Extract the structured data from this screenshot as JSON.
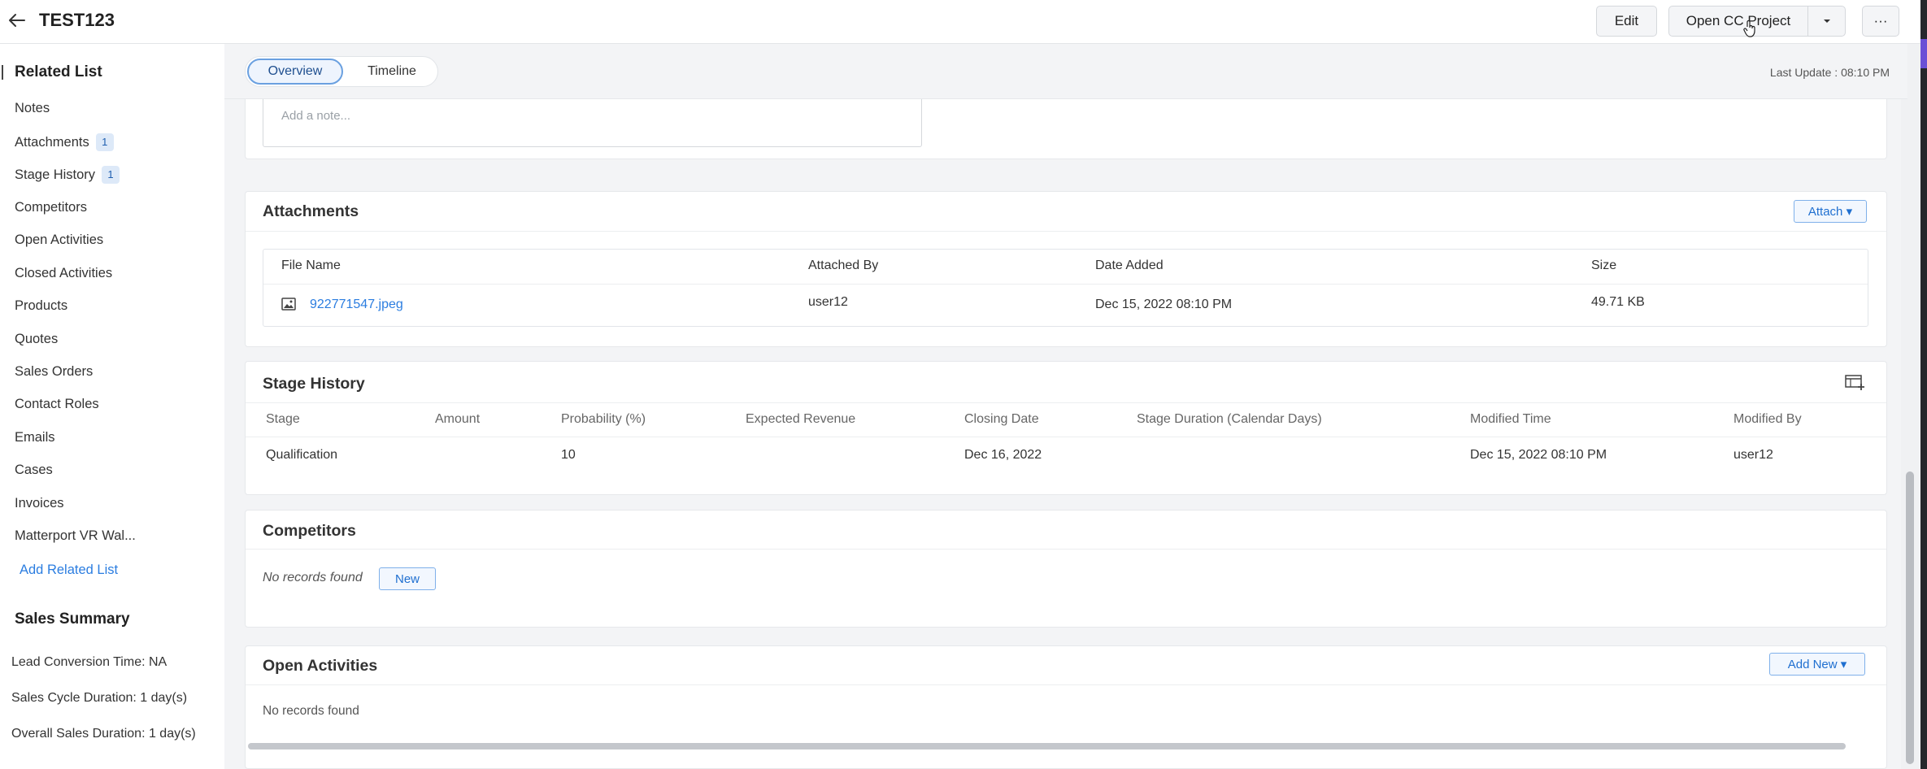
{
  "header": {
    "title": "TEST123",
    "edit_label": "Edit",
    "open_project_label": "Open CC Project",
    "more_label": "···"
  },
  "sidebar": {
    "heading": "Related List",
    "items": [
      {
        "label": "Notes",
        "badge": null
      },
      {
        "label": "Attachments",
        "badge": "1"
      },
      {
        "label": "Stage History",
        "badge": "1"
      },
      {
        "label": "Competitors",
        "badge": null
      },
      {
        "label": "Open Activities",
        "badge": null
      },
      {
        "label": "Closed Activities",
        "badge": null
      },
      {
        "label": "Products",
        "badge": null
      },
      {
        "label": "Quotes",
        "badge": null
      },
      {
        "label": "Sales Orders",
        "badge": null
      },
      {
        "label": "Contact Roles",
        "badge": null
      },
      {
        "label": "Emails",
        "badge": null
      },
      {
        "label": "Cases",
        "badge": null
      },
      {
        "label": "Invoices",
        "badge": null
      },
      {
        "label": "Matterport VR Wal...",
        "badge": null
      }
    ],
    "add_related_label": "Add Related List",
    "sales_summary": {
      "heading": "Sales Summary",
      "lines": [
        "Lead Conversion Time: NA",
        "Sales Cycle Duration: 1 day(s)",
        "Overall Sales Duration: 1 day(s)"
      ]
    }
  },
  "subheader": {
    "tabs": [
      "Overview",
      "Timeline"
    ],
    "active_tab": "Overview",
    "last_update": "Last Update : 08:10 PM"
  },
  "notes": {
    "placeholder": "Add a note..."
  },
  "attachments": {
    "title": "Attachments",
    "attach_label": "Attach ▾",
    "columns": [
      "File Name",
      "Attached By",
      "Date Added",
      "Size"
    ],
    "rows": [
      {
        "file_name": "922771547.jpeg",
        "attached_by": "user12",
        "date_added": "Dec 15, 2022 08:10 PM",
        "size": "49.71 KB"
      }
    ]
  },
  "stage_history": {
    "title": "Stage History",
    "columns": [
      "Stage",
      "Amount",
      "Probability (%)",
      "Expected Revenue",
      "Closing Date",
      "Stage Duration (Calendar Days)",
      "Modified Time",
      "Modified By"
    ],
    "rows": [
      {
        "stage": "Qualification",
        "amount": "",
        "probability": "10",
        "expected_revenue": "",
        "closing_date": "Dec 16, 2022",
        "stage_duration": "",
        "modified_time": "Dec 15, 2022 08:10 PM",
        "modified_by": "user12"
      }
    ]
  },
  "competitors": {
    "title": "Competitors",
    "empty_text": "No records found",
    "new_label": "New"
  },
  "open_activities": {
    "title": "Open Activities",
    "add_new_label": "Add New ▾",
    "empty_text": "No records found"
  },
  "colors": {
    "accent": "#2b7de0",
    "badge_bg": "#dde9f8"
  }
}
